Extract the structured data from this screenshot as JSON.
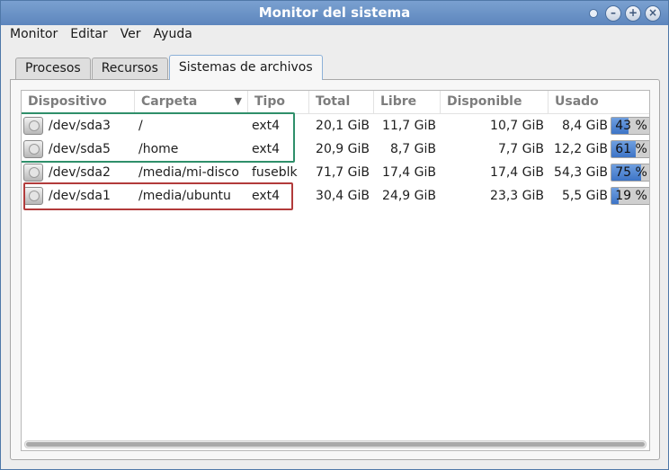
{
  "window": {
    "title": "Monitor del sistema"
  },
  "menu": [
    "Monitor",
    "Editar",
    "Ver",
    "Ayuda"
  ],
  "tabs": [
    {
      "label": "Procesos",
      "active": false
    },
    {
      "label": "Recursos",
      "active": false
    },
    {
      "label": "Sistemas de archivos",
      "active": true
    }
  ],
  "columns": {
    "device": "Dispositivo",
    "folder": "Carpeta",
    "type": "Tipo",
    "total": "Total",
    "free": "Libre",
    "available": "Disponible",
    "used": "Usado"
  },
  "rows": [
    {
      "device": "/dev/sda3",
      "folder": "/",
      "type": "ext4",
      "total": "20,1 GiB",
      "free": "11,7 GiB",
      "available": "10,7 GiB",
      "used": "8,4 GiB",
      "percent_label": "43 %",
      "percent": 43
    },
    {
      "device": "/dev/sda5",
      "folder": "/home",
      "type": "ext4",
      "total": "20,9 GiB",
      "free": "8,7 GiB",
      "available": "7,7 GiB",
      "used": "12,2 GiB",
      "percent_label": "61 %",
      "percent": 61
    },
    {
      "device": "/dev/sda2",
      "folder": "/media/mi-disco",
      "type": "fuseblk",
      "total": "71,7 GiB",
      "free": "17,4 GiB",
      "available": "17,4 GiB",
      "used": "54,3 GiB",
      "percent_label": "75 %",
      "percent": 75
    },
    {
      "device": "/dev/sda1",
      "folder": "/media/ubuntu",
      "type": "ext4",
      "total": "30,4 GiB",
      "free": "24,9 GiB",
      "available": "23,3 GiB",
      "used": "5,5 GiB",
      "percent_label": "19 %",
      "percent": 19
    }
  ],
  "colors": {
    "highlight_green": "#2f8f6a",
    "highlight_red": "#b23b3b",
    "bar_fill": "#3d74c6"
  }
}
